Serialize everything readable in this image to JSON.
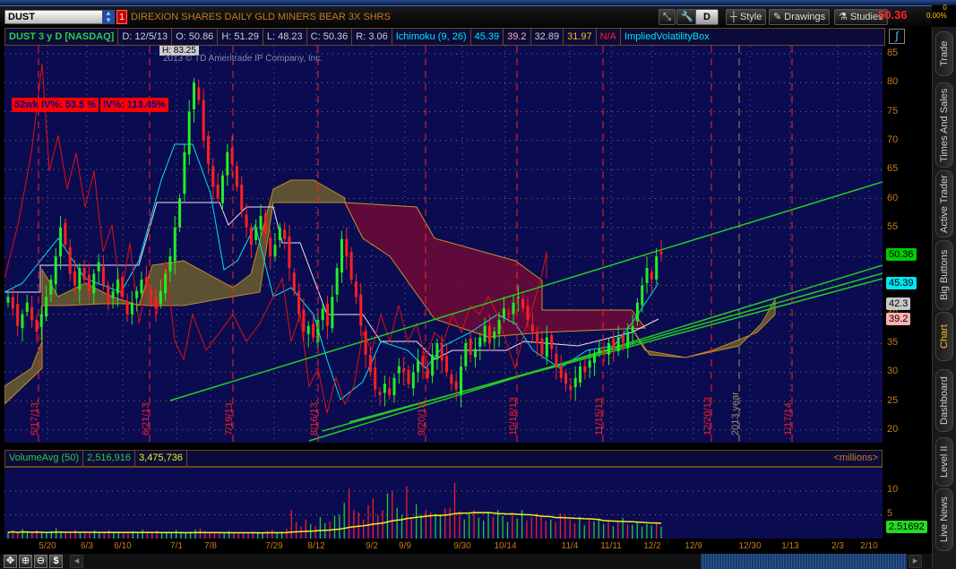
{
  "toolbar": {
    "symbol": "DUST",
    "alert_count": "1",
    "description": "DIREXION SHARES DAILY GLD MINERS BEAR 3X SHRS",
    "aggregation": "D",
    "style": "Style",
    "drawings": "Drawings",
    "studies": "Studies",
    "last": "50.36",
    "net_change": "0",
    "pct_change": "0.00%"
  },
  "info": {
    "title": "DUST 3 y D [NASDAQ]",
    "date": "D: 12/5/13",
    "open": "O: 50.86",
    "high": "H: 51.29",
    "low": "L: 48.23",
    "close": "C: 50.36",
    "range": "R: 3.06",
    "study": "Ichimoku (9, 26)",
    "ich1": "45.39",
    "ich2": "39.2",
    "ich3": "32.89",
    "ich4": "31.97",
    "ich5": "N/A",
    "study2": "ImpliedVolatilityBox"
  },
  "overlay": {
    "iv52": "52wk IV%: 53.5 %",
    "iv": "IV%: 113.45%",
    "high_marker": "H: 83.25",
    "copyright": "2013 © TD Ameritrade IP Company, Inc."
  },
  "price_axis": [
    "85",
    "80",
    "75",
    "70",
    "65",
    "60",
    "55",
    "50",
    "45",
    "40",
    "35",
    "30",
    "25",
    "20"
  ],
  "price_badges": [
    {
      "v": "50.36",
      "color": "#00cc00"
    },
    {
      "v": "45.39",
      "color": "#00e5ee"
    },
    {
      "v": "42.3",
      "color": "#c8c8c8"
    },
    {
      "v": "39.2",
      "color": "#ffb0b0"
    }
  ],
  "expiry_labels": [
    "5/17/13",
    "6/21/13",
    "7/19/13",
    "8/16/13",
    "9/20/13",
    "10/18/13",
    "11/15/13",
    "12/20/13",
    "2013 year",
    "1/17/14"
  ],
  "volume": {
    "study": "VolumeAvg (50)",
    "vol": "2,516,916",
    "avg": "3,475,736",
    "units": "<millions>",
    "axis": [
      "10",
      "5"
    ],
    "badge": "2.51692"
  },
  "date_axis": [
    "5/20",
    "6/3",
    "6/10",
    "7/1",
    "7/8",
    "7/29",
    "8/12",
    "9/2",
    "9/9",
    "9/30",
    "10/14",
    "11/4",
    "11/11",
    "12/2",
    "12/9",
    "12/30",
    "1/13",
    "2/3",
    "2/10"
  ],
  "side_tabs": [
    "Trade",
    "Times And Sales",
    "Active Trader",
    "Big Buttons",
    "Chart",
    "Dashboard",
    "Level II",
    "Live News"
  ],
  "chart": {
    "closes": [
      43,
      41,
      38,
      40,
      42,
      39,
      37,
      40,
      43,
      46,
      50,
      55,
      52,
      47,
      45,
      48,
      46,
      44,
      47,
      49,
      45,
      42,
      44,
      46,
      43,
      40,
      42,
      44,
      46,
      45,
      43,
      41,
      44,
      47,
      50,
      55,
      60,
      68,
      75,
      80,
      77,
      70,
      66,
      62,
      60,
      64,
      68,
      66,
      62,
      58,
      55,
      52,
      55,
      57,
      54,
      50,
      52,
      55,
      53,
      48,
      44,
      40,
      37,
      38,
      36,
      39,
      41,
      38,
      43,
      48,
      53,
      50,
      46,
      43,
      38,
      33,
      30,
      27,
      26,
      28,
      26,
      29,
      31,
      30,
      28,
      30,
      32,
      31,
      29,
      33,
      35,
      32,
      30,
      28,
      27,
      31,
      35,
      33,
      34,
      36,
      38,
      35,
      37,
      39,
      41,
      40,
      42,
      43,
      41,
      39,
      37,
      35,
      33,
      36,
      34,
      31,
      29,
      28,
      27,
      29,
      31,
      30,
      32,
      33,
      34,
      33,
      35,
      34,
      36,
      35,
      37,
      38,
      42,
      45,
      48,
      46,
      50,
      50.36
    ],
    "volumes": [
      1.5,
      1.8,
      1.2,
      2,
      1.5,
      1.3,
      1.8,
      1.4,
      1.1,
      1.6,
      2.2,
      1.5,
      1.4,
      1.3,
      1.9,
      1.2,
      1.5,
      1.1,
      1.7,
      1.3,
      1.4,
      1.8,
      1.2,
      1.5,
      1.3,
      1.1,
      1.6,
      1.4,
      1.9,
      1.5,
      1.2,
      1.7,
      1.3,
      1.4,
      1.1,
      1.8,
      1.4,
      1.2,
      1.5,
      1.9,
      2.1,
      1.6,
      1.4,
      1.2,
      1.3,
      1.1,
      1.6,
      1.4,
      1.2,
      1.3,
      1.1,
      1.5,
      1.4,
      1.2,
      1.6,
      1.8,
      1.3,
      1.5,
      2.1,
      6,
      3.5,
      2.5,
      4,
      3,
      2.6,
      4.5,
      3.2,
      3.6,
      4.8,
      5,
      7.5,
      10.5,
      6,
      5.5,
      4,
      7,
      8.5,
      5,
      6,
      9.5,
      10,
      6.5,
      5,
      11,
      4.5,
      7.2,
      5,
      6,
      5.5,
      5.2,
      4.8,
      6.3,
      6.5,
      11.7,
      5.8,
      4,
      5.2,
      6,
      4.4,
      3.8,
      5.5,
      4.5,
      6,
      4.8,
      3.5,
      5,
      4.2,
      6,
      3.8,
      4.5,
      5.2,
      4.6,
      3.7,
      4,
      3.5,
      5.3,
      5,
      4.1,
      3.2,
      4.5,
      2.8,
      3.9,
      3.6,
      4.2,
      3.1,
      3.8,
      2.6,
      3.5,
      4.4,
      3,
      2.9,
      3.4,
      2.5,
      3.1,
      2.7,
      3.3,
      2.5
    ]
  }
}
